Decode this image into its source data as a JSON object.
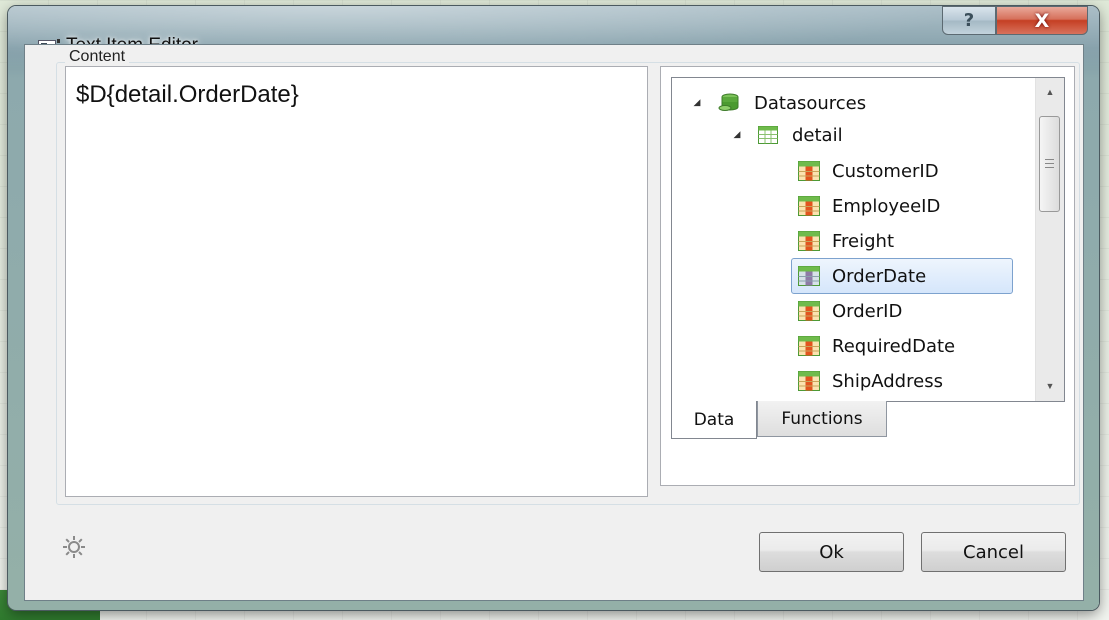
{
  "window": {
    "title": "Text Item Editor",
    "help_label": "?",
    "close_label": "X"
  },
  "content": {
    "legend": "Content",
    "expression": "$D{detail.OrderDate}"
  },
  "tree": {
    "root_label": "Datasources",
    "table_label": "detail",
    "fields": [
      "CustomerID",
      "EmployeeID",
      "Freight",
      "OrderDate",
      "OrderID",
      "RequiredDate",
      "ShipAddress"
    ],
    "selected_field": "OrderDate"
  },
  "tabs": [
    {
      "label": "Data",
      "active": true
    },
    {
      "label": "Functions",
      "active": false
    }
  ],
  "buttons": {
    "ok": "Ok",
    "cancel": "Cancel"
  },
  "icons": {
    "settings": "gear-icon",
    "database": "database-icon",
    "table": "table-icon",
    "field": "field-icon"
  },
  "colors": {
    "selection_border": "#7da2ce",
    "selection_fill": "#d5e6fb",
    "close_button": "#c53f23"
  }
}
